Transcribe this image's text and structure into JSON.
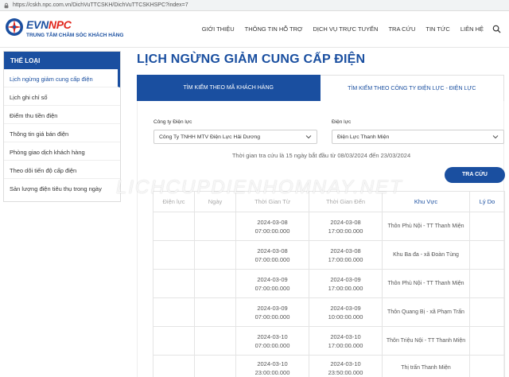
{
  "browser": {
    "url": "https://cskh.npc.com.vn/DichVuTTCSKH/DichVuTTCSKHSPC?index=7"
  },
  "header": {
    "brand_evn": "EVN",
    "brand_npc": "NPC",
    "tagline": "TRUNG TÂM CHĂM SÓC KHÁCH HÀNG",
    "nav": [
      "GIỚI THIỆU",
      "THÔNG TIN HỖ TRỢ",
      "DỊCH VỤ TRỰC TUYẾN",
      "TRA CỨU",
      "TIN TỨC",
      "LIÊN HỆ"
    ]
  },
  "sidebar": {
    "title": "THỂ LOẠI",
    "items": [
      "Lịch ngừng giảm cung cấp điện",
      "Lịch ghi chỉ số",
      "Điểm thu tiền điện",
      "Thông tin giá bán điện",
      "Phòng giao dịch khách hàng",
      "Theo dõi tiến độ cấp điện",
      "Sản lượng điện tiêu thụ trong ngày"
    ]
  },
  "main": {
    "title": "LỊCH NGỪNG GIẢM CUNG CẤP ĐIỆN",
    "tabs": [
      "TÌM KIẾM THEO MÃ KHÁCH HÀNG",
      "TÌM KIẾM THEO CÔNG TY ĐIỆN LỰC - ĐIỆN LỰC"
    ],
    "company_label": "Công ty Điện lực",
    "company_value": "Công Ty TNHH MTV Điện Lực Hải Dương",
    "branch_label": "Điện lực",
    "branch_value": "Điện Lực Thanh Miện",
    "range_note": "Thời gian tra cứu là 15 ngày bắt đầu từ 08/03/2024 đến 23/03/2024",
    "search_button": "TRA CỨU",
    "watermark": "LICHCUPDIENHOMNAY.NET"
  },
  "table": {
    "headers": [
      "Điện lực",
      "Ngày",
      "Thời Gian Từ",
      "Thời Gian Đến",
      "Khu Vực",
      "Lý Do"
    ],
    "rows": [
      {
        "from_date": "2024-03-08",
        "from_time": "07:00:00.000",
        "to_date": "2024-03-08",
        "to_time": "17:00:00.000",
        "area": "Thôn Phù Nội - TT Thanh Miện"
      },
      {
        "from_date": "2024-03-08",
        "from_time": "07:00:00.000",
        "to_date": "2024-03-08",
        "to_time": "17:00:00.000",
        "area": "Khu Ba đa - xã Đoàn Tùng"
      },
      {
        "from_date": "2024-03-09",
        "from_time": "07:00:00.000",
        "to_date": "2024-03-09",
        "to_time": "17:00:00.000",
        "area": "Thôn Phù Nội - TT Thanh Miện"
      },
      {
        "from_date": "2024-03-09",
        "from_time": "07:00:00.000",
        "to_date": "2024-03-09",
        "to_time": "10:00:00.000",
        "area": "Thôn Quang Bị - xã Phạm Trấn"
      },
      {
        "from_date": "2024-03-10",
        "from_time": "07:00:00.000",
        "to_date": "2024-03-10",
        "to_time": "17:00:00.000",
        "area": "Thôn Triệu Nội - TT Thanh Miện"
      },
      {
        "from_date": "2024-03-10",
        "from_time": "23:00:00.000",
        "to_date": "2024-03-10",
        "to_time": "23:50:00.000",
        "area": "Thị trấn Thanh Miện"
      }
    ]
  }
}
